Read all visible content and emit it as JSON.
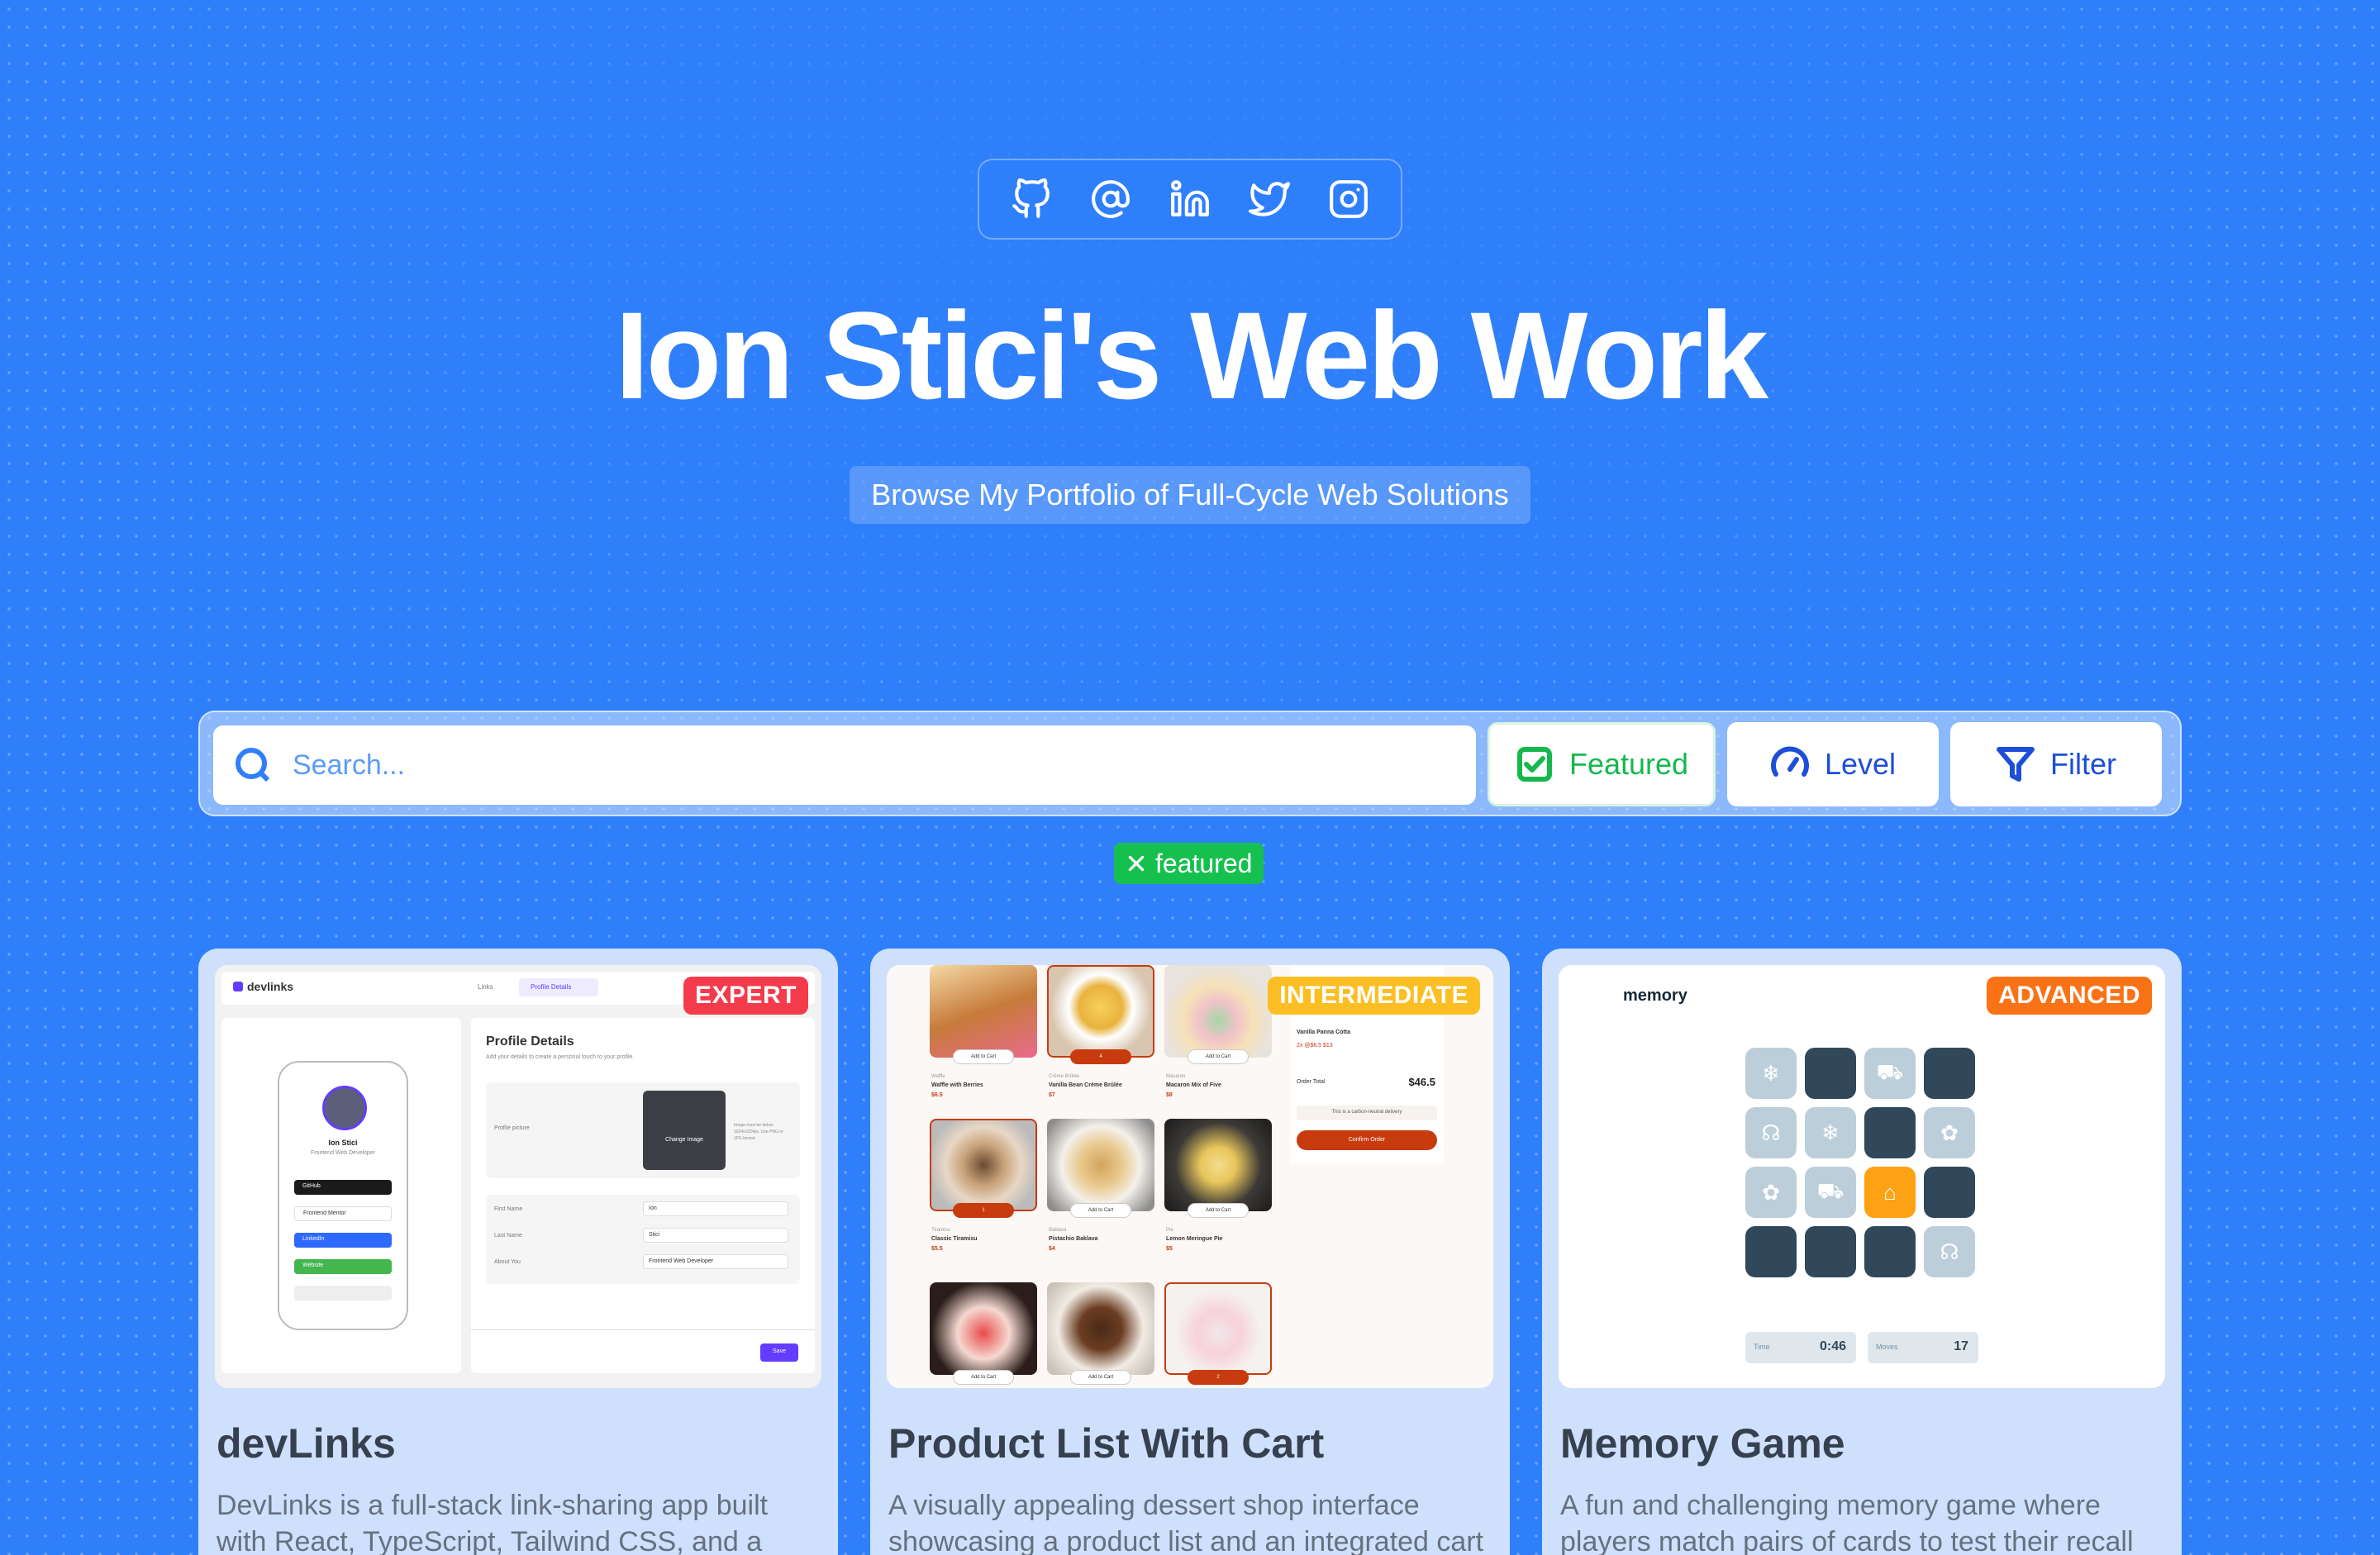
{
  "social": {
    "icons": [
      "github-icon",
      "at-sign-icon",
      "linkedin-icon",
      "twitter-icon",
      "instagram-icon"
    ]
  },
  "hero": {
    "title": "Ion Stici's Web Work",
    "subtitle": "Browse My Portfolio of Full-Cycle Web Solutions"
  },
  "toolbar": {
    "search_placeholder": "Search...",
    "featured_label": "Featured",
    "level_label": "Level",
    "filter_label": "Filter"
  },
  "active_filter": {
    "label": "featured"
  },
  "colors": {
    "background": "#2f7ffb",
    "featured": "#16b84e",
    "expert": "#f43b4b",
    "intermediate": "#fbbf24",
    "advanced": "#f97316"
  },
  "cards": [
    {
      "title": "devLinks",
      "level": "EXPERT",
      "description": "DevLinks is a full-stack link-sharing app built with React, TypeScript, Tailwind CSS, and a",
      "preview": {
        "logo": "devlinks",
        "tab_links": "Links",
        "tab_profile": "Profile Details",
        "heading": "Profile Details",
        "desc": "Add your details to create a personal touch to your profile.",
        "pic_label": "Profile picture",
        "change_image": "Change Image",
        "img_hint": "Image must be below 1024x1024px. Use PNG or JPG format.",
        "name": "Ion Stici",
        "role": "Frontend Web Developer",
        "links": [
          "GitHub",
          "Frontend Mentor",
          "LinkedIn",
          "Website"
        ],
        "first_name_label": "First Name",
        "first_name": "Ion",
        "last_name_label": "Last Name",
        "last_name": "Stici",
        "about_label": "About You",
        "about": "Frontend Web Developer",
        "save": "Save"
      }
    },
    {
      "title": "Product List With Cart",
      "level": "INTERMEDIATE",
      "description": "A visually appealing dessert shop interface showcasing a product list and an integrated cart",
      "preview": {
        "add_to_cart": "Add to Cart",
        "items": [
          {
            "cat": "Waffle",
            "name": "Waffle with Berries",
            "price": "$6.5"
          },
          {
            "cat": "Crème Brûlée",
            "name": "Vanilla Bean Crème Brûlée",
            "price": "$7"
          },
          {
            "cat": "Macaron",
            "name": "Macaron Mix of Five",
            "price": "$8"
          },
          {
            "cat": "Tiramisu",
            "name": "Classic Tiramisu",
            "price": "$5.5"
          },
          {
            "cat": "Baklava",
            "name": "Pistachio Baklava",
            "price": "$4"
          },
          {
            "cat": "Pie",
            "name": "Lemon Meringue Pie",
            "price": "$5"
          }
        ],
        "qty_1": "4",
        "qty_2": "1",
        "qty_3": "2",
        "cart_item": "Vanilla Panna Cotta",
        "cart_item_detail": "2x @$6.5 $13",
        "order_total_label": "Order Total",
        "order_total": "$46.5",
        "carbon_note": "This is a carbon-neutral delivery",
        "confirm": "Confirm Order"
      }
    },
    {
      "title": "Memory Game",
      "level": "ADVANCED",
      "description": "A fun and challenging memory game where players match pairs of cards to test their recall",
      "preview": {
        "logo": "memory",
        "time_label": "Time",
        "time": "0:46",
        "moves_label": "Moves",
        "moves": "17"
      }
    }
  ]
}
